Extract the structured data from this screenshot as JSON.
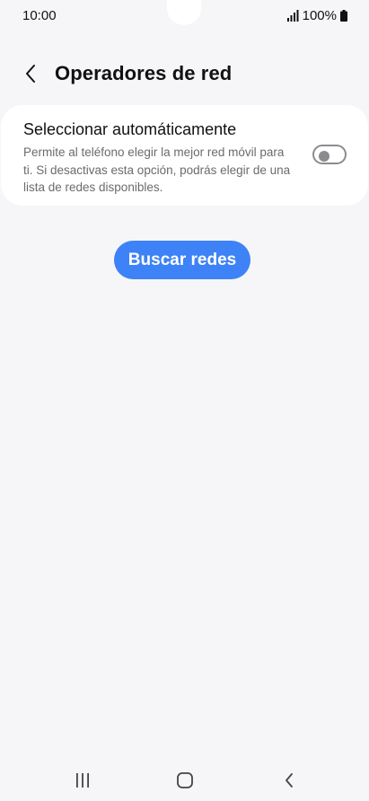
{
  "status_bar": {
    "time": "10:00",
    "battery": "100%",
    "icons": [
      "signal-icon",
      "battery-icon"
    ]
  },
  "header": {
    "title": "Operadores de red",
    "back_icon": "chevron-left-icon"
  },
  "auto_select": {
    "title": "Seleccionar automáticamente",
    "description": "Permite al teléfono elegir la mejor red móvil para ti. Si desactivas esta opción, podrás elegir de una lista de redes disponibles.",
    "enabled": false
  },
  "search_button": {
    "label": "Buscar redes"
  },
  "colors": {
    "background": "#f6f6f8",
    "card": "#ffffff",
    "accent": "#3e82f7",
    "toggle_off": "#8c8c90",
    "secondary_text": "#6b6b6f"
  },
  "nav_bar": {
    "icons": [
      "recents-icon",
      "home-icon",
      "back-icon"
    ]
  }
}
